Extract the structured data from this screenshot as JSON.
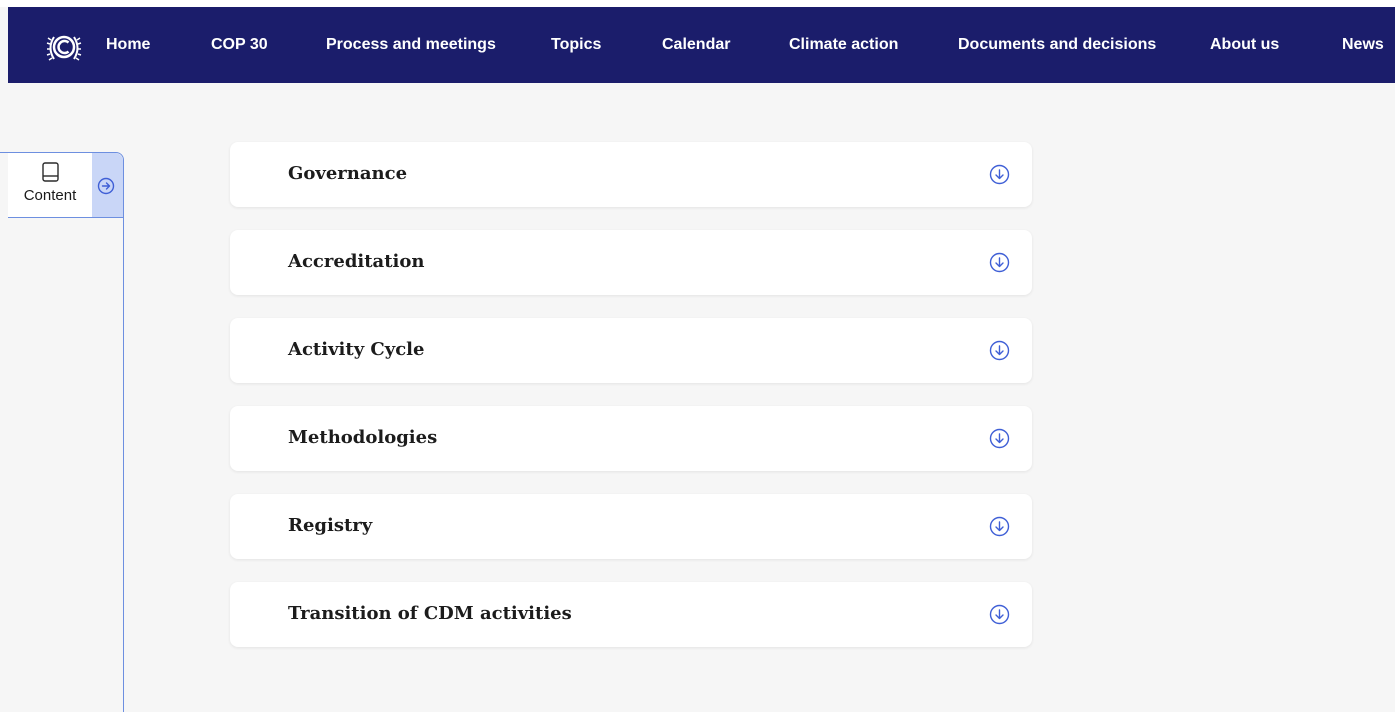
{
  "nav": {
    "logo_icon": "unfccc-emblem-icon",
    "items": [
      {
        "label": "Home"
      },
      {
        "label": "COP 30"
      },
      {
        "label": "Process and meetings"
      },
      {
        "label": "Topics"
      },
      {
        "label": "Calendar"
      },
      {
        "label": "Climate action"
      },
      {
        "label": "Documents and decisions"
      },
      {
        "label": "About us"
      },
      {
        "label": "News"
      }
    ]
  },
  "sidebar": {
    "tab_label": "Content",
    "tab_icon": "book-icon",
    "toggle_icon": "arrow-right-circle-icon"
  },
  "accordion": {
    "expand_icon": "arrow-down-circle-icon",
    "items": [
      {
        "title": "Governance"
      },
      {
        "title": "Accreditation"
      },
      {
        "title": "Activity Cycle"
      },
      {
        "title": "Methodologies"
      },
      {
        "title": "Registry"
      },
      {
        "title": "Transition of CDM activities"
      }
    ]
  },
  "colors": {
    "navbar_bg": "#1b1d6b",
    "accent_blue": "#3f5fd6",
    "page_bg": "#f6f6f6",
    "sidetab_arrow_bg": "#c9d6f7"
  }
}
